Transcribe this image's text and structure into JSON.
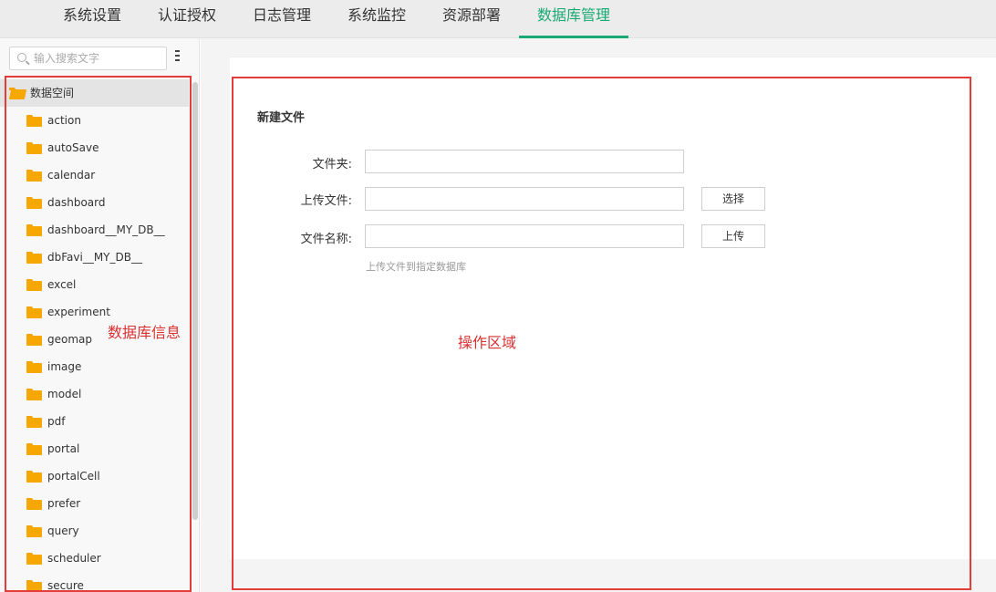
{
  "tabs": [
    {
      "label": "系统设置",
      "active": false
    },
    {
      "label": "认证授权",
      "active": false
    },
    {
      "label": "日志管理",
      "active": false
    },
    {
      "label": "系统监控",
      "active": false
    },
    {
      "label": "资源部署",
      "active": false
    },
    {
      "label": "数据库管理",
      "active": true
    }
  ],
  "colors": {
    "accent": "#19a974",
    "annotation": "#e43b3b",
    "folder": "#f7a800"
  },
  "sidebar": {
    "search_placeholder": "输入搜索文字",
    "root": "数据空间",
    "items": [
      "action",
      "autoSave",
      "calendar",
      "dashboard",
      "dashboard__MY_DB__",
      "dbFavi__MY_DB__",
      "excel",
      "experiment",
      "geomap",
      "image",
      "model",
      "pdf",
      "portal",
      "portalCell",
      "prefer",
      "query",
      "scheduler",
      "secure"
    ]
  },
  "form": {
    "title": "新建文件",
    "folder_label": "文件夹:",
    "upload_label": "上传文件:",
    "name_label": "文件名称:",
    "folder_value": "",
    "upload_value": "",
    "name_value": "",
    "choose_button": "选择",
    "upload_button": "上传",
    "hint": "上传文件到指定数据库"
  },
  "annotations": {
    "left": "数据库信息",
    "right": "操作区域"
  }
}
